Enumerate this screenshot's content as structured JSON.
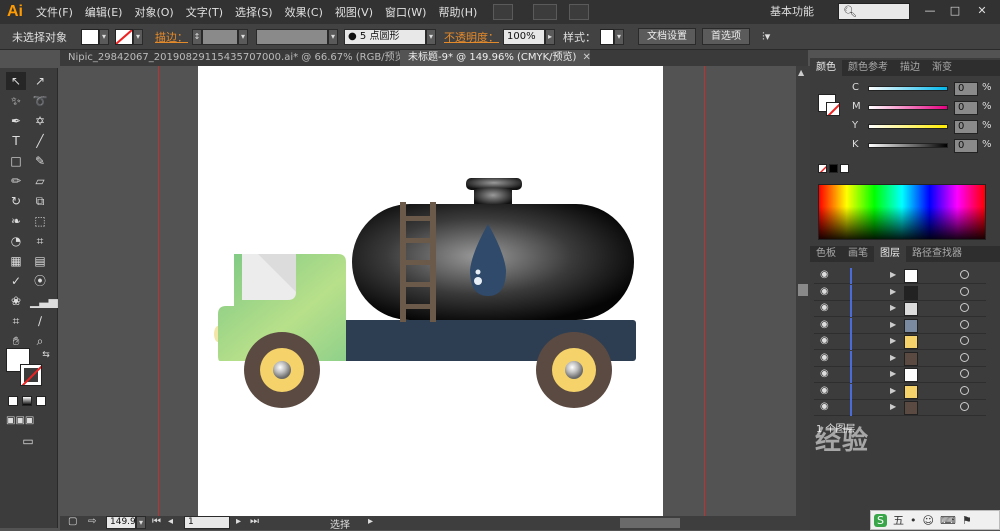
{
  "app": {
    "logo": "Ai"
  },
  "menu": {
    "items": [
      "文件(F)",
      "编辑(E)",
      "对象(O)",
      "文字(T)",
      "选择(S)",
      "效果(C)",
      "视图(V)",
      "窗口(W)",
      "帮助(H)"
    ],
    "workspace": "基本功能",
    "search_placeholder": ""
  },
  "control_bar": {
    "selection_status": "未选择对象",
    "stroke_label": "描边：",
    "brush_value": "5 点圆形",
    "opacity_label": "不透明度：",
    "opacity_value": "100%",
    "style_label": "样式：",
    "doc_settings_button": "文档设置",
    "preferences_button": "首选项"
  },
  "tabs": [
    {
      "label": "Nipic_29842067_20190829115435707000.ai* @ 66.67% (RGB/预览)",
      "active": false
    },
    {
      "label": "未标题-9* @ 149.96% (CMYK/预览)",
      "active": true
    }
  ],
  "status_bar": {
    "zoom": "149.96",
    "artboard": "1",
    "tool_status": "选择"
  },
  "color_panel": {
    "tabs": [
      "颜色",
      "颜色参考",
      "描边",
      "渐变"
    ],
    "channels": [
      {
        "name": "C",
        "value": "0",
        "unit": "%"
      },
      {
        "name": "M",
        "value": "0",
        "unit": "%"
      },
      {
        "name": "Y",
        "value": "0",
        "unit": "%"
      },
      {
        "name": "K",
        "value": "0",
        "unit": "%"
      }
    ]
  },
  "layers_panel": {
    "tabs": [
      "色板",
      "画笔",
      "图层",
      "路径查找器"
    ],
    "rows": 9,
    "footer": "1 个图层"
  },
  "watermark": "经验",
  "ime": {
    "label": "五"
  },
  "colors": {
    "menubar_bg": "#323232",
    "panel_bg": "#3c3c3c",
    "canvas_bg": "#535353",
    "accent_orange": "#ff9a00",
    "guide_red": "#c03030",
    "truck_cab_green": "#9ad48a",
    "truck_chassis": "#2e3e52",
    "tank_black": "#111111",
    "ladder_brown": "#6b5a4a",
    "wheel_brown": "#5b4a42",
    "hubcap_yellow": "#f5d36a",
    "drop_blue": "#2f4a6b"
  }
}
